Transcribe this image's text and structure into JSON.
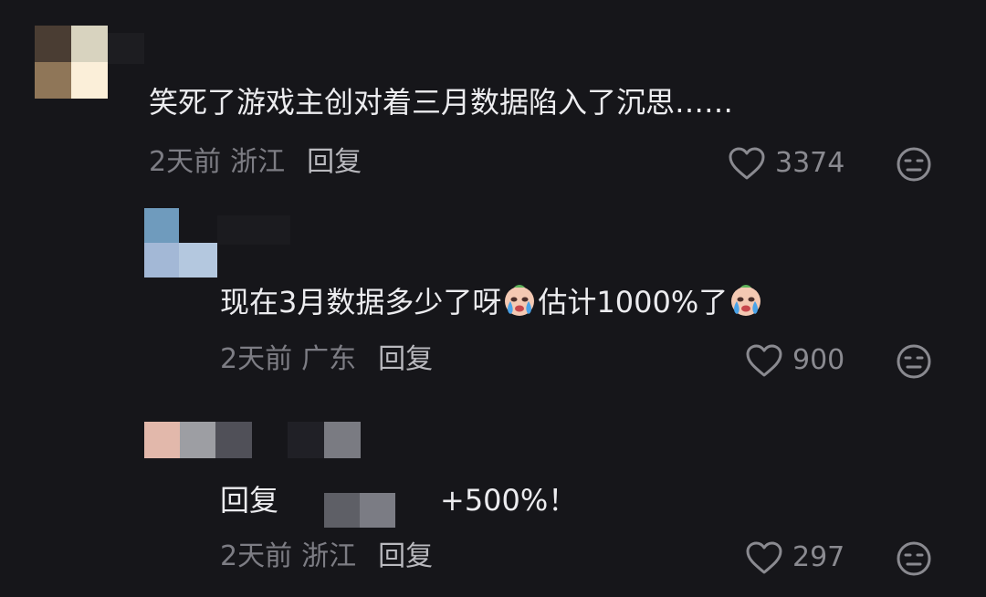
{
  "comments": [
    {
      "text": "笑死了游戏主创对着三月数据陷入了沉思……",
      "time": "2天前",
      "location": "浙江",
      "reply_label": "回复",
      "likes": "3374",
      "icons": {
        "like": "heart-outline-icon",
        "dislike": "meh-face-icon"
      }
    },
    {
      "text_before_emoji": "现在3月数据多少了呀",
      "text_middle": "估计1000%了",
      "emoji": "crying-face-emoji",
      "time": "2天前",
      "location": "广东",
      "reply_label": "回复",
      "likes": "900"
    },
    {
      "reply_prefix": "回复",
      "text": "+500%！",
      "time": "2天前",
      "location": "浙江",
      "reply_label": "回复",
      "likes": "297"
    }
  ],
  "colors": {
    "background": "#16161a",
    "primary_text": "#ececef",
    "secondary_text": "#7d7d84"
  }
}
